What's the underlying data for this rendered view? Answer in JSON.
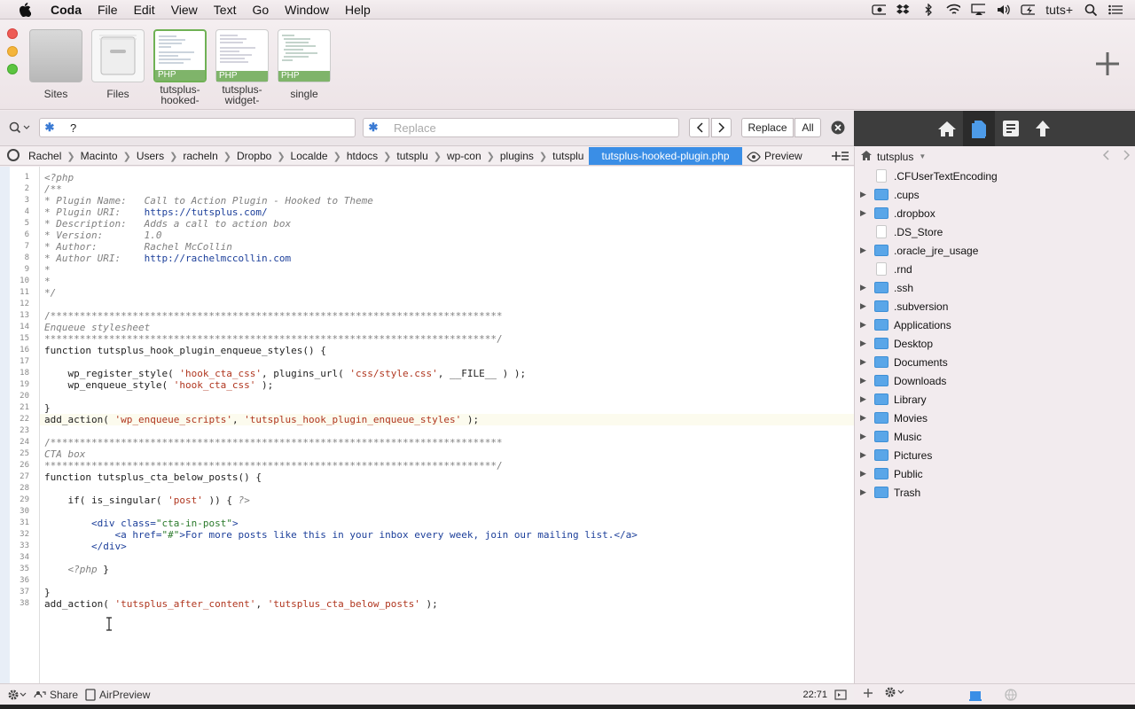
{
  "menubar": {
    "app_name": "Coda",
    "items": [
      "File",
      "Edit",
      "View",
      "Text",
      "Go",
      "Window",
      "Help"
    ],
    "user": "tuts+"
  },
  "tabs": {
    "sites_label": "Sites",
    "files_label": "Files",
    "tab1_label": "tutsplus-hooked-",
    "tab2_label": "tutsplus-widget-",
    "tab3_label": "single",
    "badge": "PHP"
  },
  "find": {
    "search_value": "?",
    "replace_placeholder": "Replace",
    "replace_label": "Replace",
    "all_label": "All"
  },
  "breadcrumbs": {
    "items": [
      "Rachel",
      "Macinto",
      "Users",
      "racheln",
      "Dropbo",
      "Localde",
      "htdocs",
      "tutsplu",
      "wp-con",
      "plugins",
      "tutsplu"
    ],
    "active": "tutsplus-hooked-plugin.php",
    "preview": "Preview"
  },
  "editor": {
    "line_numbers": [
      "1",
      "2",
      "3",
      "4",
      "5",
      "6",
      "7",
      "8",
      "9",
      "10",
      "11",
      "12",
      "13",
      "14",
      "15",
      "16",
      "17",
      "18",
      "19",
      "20",
      "21",
      "22",
      "23",
      "24",
      "25",
      "26",
      "27",
      "28",
      "29",
      "30",
      "31",
      "32",
      "33",
      "34",
      "35",
      "36",
      "37",
      "38"
    ],
    "l1": "<?php",
    "l2": "/**",
    "l3": "* Plugin Name:   Call to Action Plugin - Hooked to Theme",
    "l4a": "* Plugin URI:    ",
    "l4b": "https://tutsplus.com/",
    "l5": "* Description:   Adds a call to action box",
    "l6": "* Version:       1.0",
    "l7": "* Author:        Rachel McCollin",
    "l8a": "* Author URI:    ",
    "l8b": "http://rachelmccollin.com",
    "l9": "*",
    "l10": "*",
    "l11": "*/",
    "l13": "/*****************************************************************************",
    "l14": "Enqueue stylesheet",
    "l15": "*****************************************************************************/",
    "l16": "function tutsplus_hook_plugin_enqueue_styles() {",
    "l18a": "    wp_register_style( ",
    "l18b": "'hook_cta_css'",
    "l18c": ", plugins_url( ",
    "l18d": "'css/style.css'",
    "l18e": ", __FILE__ ) );",
    "l19a": "    wp_enqueue_style( ",
    "l19b": "'hook_cta_css'",
    "l19c": " );",
    "l21": "}",
    "l22a": "add_action( ",
    "l22b": "'wp_enqueue_scripts'",
    "l22c": ", ",
    "l22d": "'tutsplus_hook_plugin_enqueue_styles'",
    "l22e": " );",
    "l24": "/*****************************************************************************",
    "l25": "CTA box",
    "l26": "*****************************************************************************/",
    "l27": "function tutsplus_cta_below_posts() {",
    "l29a": "    if( is_singular( ",
    "l29b": "'post'",
    "l29c": " )) { ",
    "l29d": "?>",
    "l31a": "        <div class=",
    "l31b": "\"cta-in-post\"",
    "l31c": ">",
    "l32a": "            <a href=",
    "l32b": "\"#\"",
    "l32c": ">For more posts like this in your inbox every week, join our mailing list.</a>",
    "l33": "        </div>",
    "l35a": "    ",
    "l35b": "<?php",
    "l35c": " }",
    "l37": "}",
    "l38a": "add_action( ",
    "l38b": "'tutsplus_after_content'",
    "l38c": ", ",
    "l38d": "'tutsplus_cta_below_posts'",
    "l38e": " );"
  },
  "status": {
    "share": "Share",
    "airpreview": "AirPreview",
    "position": "22:71"
  },
  "sidebar": {
    "site": "tutsplus",
    "items": [
      ".CFUserTextEncoding",
      ".cups",
      ".dropbox",
      ".DS_Store",
      ".oracle_jre_usage",
      ".rnd",
      ".ssh",
      ".subversion",
      "Applications",
      "Desktop",
      "Documents",
      "Downloads",
      "Library",
      "Movies",
      "Music",
      "Pictures",
      "Public",
      "Trash"
    ]
  },
  "colors": {
    "accent": "#3a8ee6",
    "folder": "#5aa6e8",
    "php_badge": "#7fb46a"
  }
}
